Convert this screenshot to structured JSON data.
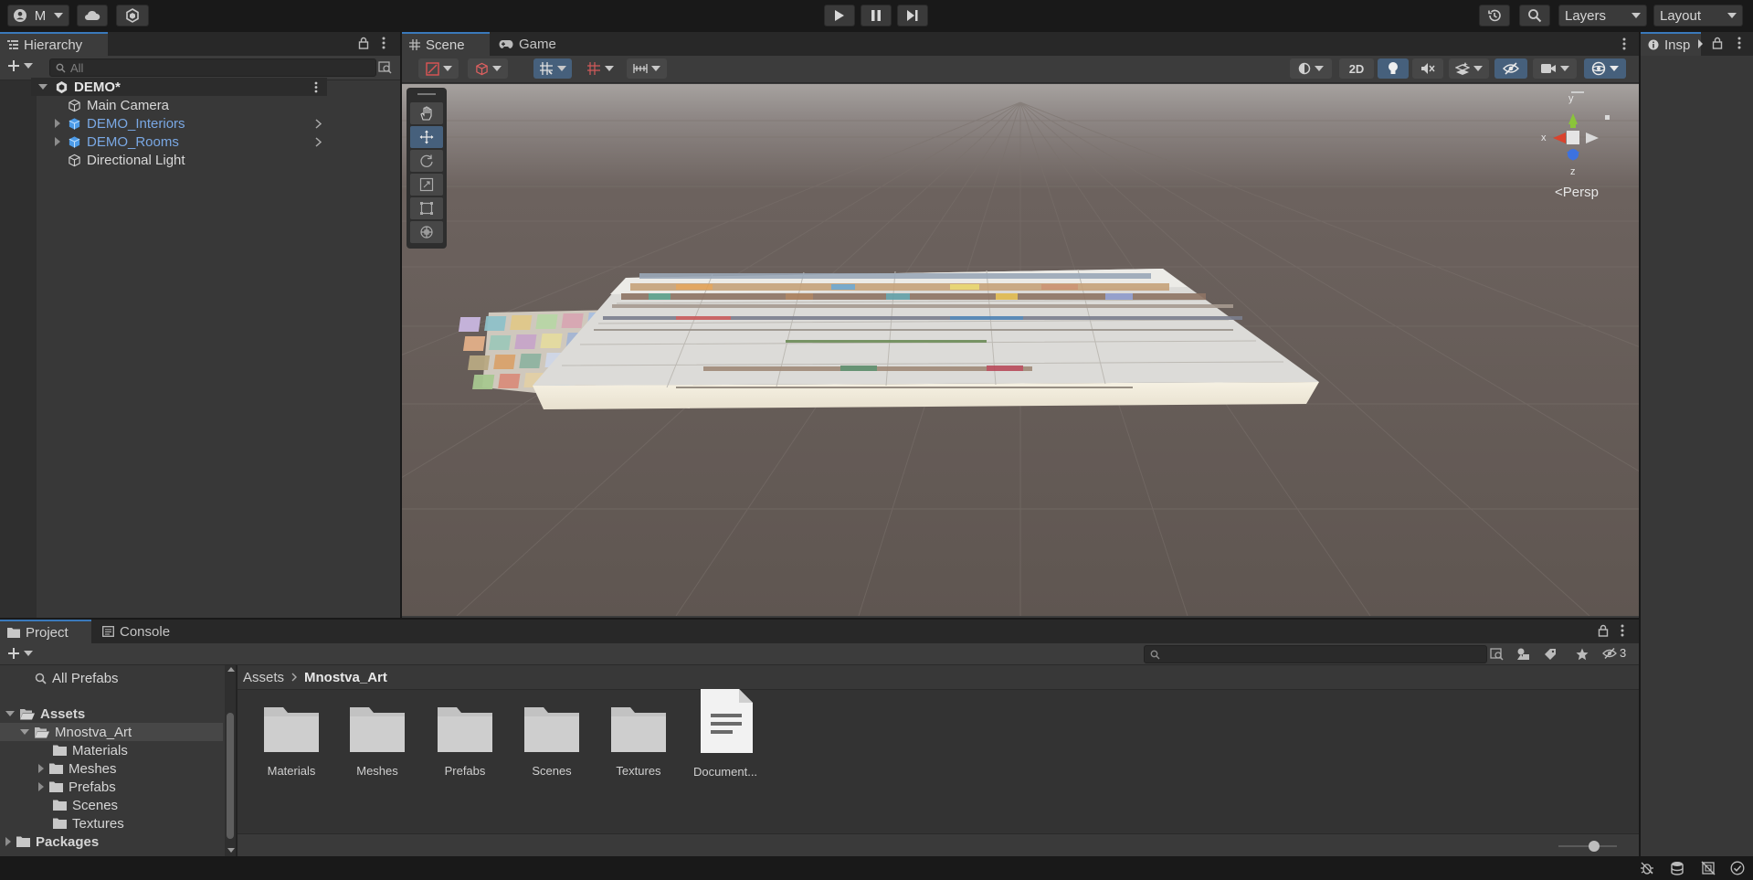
{
  "top_toolbar": {
    "account_label": "M",
    "layers_label": "Layers",
    "layout_label": "Layout"
  },
  "hierarchy": {
    "tab_label": "Hierarchy",
    "search_placeholder": "All",
    "scene_name": "DEMO*",
    "items": [
      {
        "label": "Main Camera"
      },
      {
        "label": "DEMO_Interiors"
      },
      {
        "label": "DEMO_Rooms"
      },
      {
        "label": "Directional Light"
      }
    ]
  },
  "scene_view": {
    "tab_scene": "Scene",
    "tab_game": "Game",
    "mode_2d": "2D",
    "gizmo_y": "y",
    "gizmo_x": "x",
    "gizmo_z": "z",
    "projection_label": "<Persp"
  },
  "inspector": {
    "tab_label": "Insp"
  },
  "project": {
    "tab_project": "Project",
    "tab_console": "Console",
    "all_prefabs": "All Prefabs",
    "tree": {
      "assets": "Assets",
      "mnostva": "Mnostva_Art",
      "materials": "Materials",
      "meshes": "Meshes",
      "prefabs": "Prefabs",
      "scenes": "Scenes",
      "textures": "Textures",
      "packages": "Packages"
    },
    "breadcrumb": {
      "root": "Assets",
      "current": "Mnostva_Art"
    },
    "hidden_count": "3",
    "tiles": [
      {
        "label": "Materials"
      },
      {
        "label": "Meshes"
      },
      {
        "label": "Prefabs"
      },
      {
        "label": "Scenes"
      },
      {
        "label": "Textures"
      },
      {
        "label": "Document..."
      }
    ]
  },
  "colors": {
    "accent": "#3a79bb",
    "prefab_text": "#7aa8e4",
    "panel_bg": "#383838",
    "scene_sky": "#8a8380"
  }
}
